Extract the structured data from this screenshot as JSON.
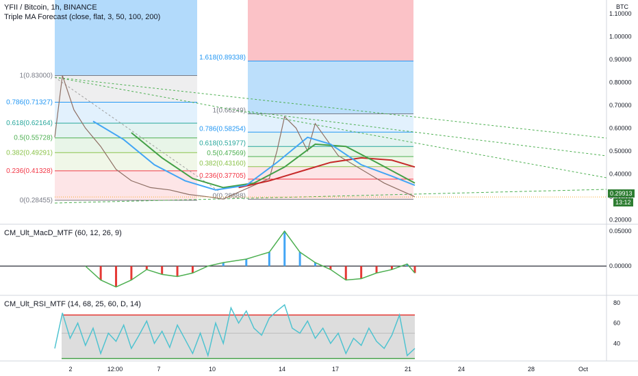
{
  "header": {
    "symbol": "YFII / Bitcoin, 1h, BINANCE",
    "indicator": "Triple MA Forecast (close, flat, 3, 50, 100, 200)",
    "currency": "BTC"
  },
  "badges": {
    "price": "0.29913",
    "countdown": "13:12"
  },
  "colors": {
    "bg": "#ffffff",
    "grid": "#e6e6e6",
    "accent_green": "#4caf50",
    "accent_red": "#e53935",
    "accent_blue": "#42a5f5",
    "rsi_line": "#4fc3d0"
  },
  "chart_data": [
    {
      "type": "line",
      "title": "YFII / Bitcoin, 1h, BINANCE",
      "y_ticks": [
        0.2,
        0.3,
        0.4,
        0.5,
        0.6,
        0.7,
        0.8,
        0.9,
        1.0,
        1.1
      ],
      "y_tick_labels": [
        "0.20000",
        "0.30000",
        "0.40000",
        "0.50000",
        "0.60000",
        "0.70000",
        "0.80000",
        "0.90000",
        "1.00000",
        "1.10000"
      ],
      "ylim": [
        0.18,
        1.16
      ],
      "x_tick_labels": [
        "2",
        "12:00",
        "7",
        "10",
        "14",
        "17",
        "21",
        "24",
        "28",
        "Oct"
      ],
      "last_price": 0.29913,
      "price_path": [
        {
          "t": 0,
          "v": 0.56
        },
        {
          "t": 2,
          "v": 0.83
        },
        {
          "t": 5,
          "v": 0.68
        },
        {
          "t": 8,
          "v": 0.6
        },
        {
          "t": 12,
          "v": 0.52
        },
        {
          "t": 16,
          "v": 0.42
        },
        {
          "t": 20,
          "v": 0.37
        },
        {
          "t": 25,
          "v": 0.34
        },
        {
          "t": 30,
          "v": 0.33
        },
        {
          "t": 35,
          "v": 0.31
        },
        {
          "t": 40,
          "v": 0.3
        },
        {
          "t": 44,
          "v": 0.29
        },
        {
          "t": 48,
          "v": 0.32
        },
        {
          "t": 52,
          "v": 0.35
        },
        {
          "t": 56,
          "v": 0.38
        },
        {
          "t": 58,
          "v": 0.5
        },
        {
          "t": 60,
          "v": 0.65
        },
        {
          "t": 63,
          "v": 0.6
        },
        {
          "t": 66,
          "v": 0.5
        },
        {
          "t": 68,
          "v": 0.62
        },
        {
          "t": 71,
          "v": 0.55
        },
        {
          "t": 74,
          "v": 0.48
        },
        {
          "t": 78,
          "v": 0.44
        },
        {
          "t": 82,
          "v": 0.4
        },
        {
          "t": 86,
          "v": 0.36
        },
        {
          "t": 90,
          "v": 0.33
        },
        {
          "t": 94,
          "v": 0.3
        }
      ],
      "ma_green": [
        {
          "t": 20,
          "v": 0.58
        },
        {
          "t": 28,
          "v": 0.47
        },
        {
          "t": 36,
          "v": 0.38
        },
        {
          "t": 44,
          "v": 0.34
        },
        {
          "t": 52,
          "v": 0.36
        },
        {
          "t": 60,
          "v": 0.43
        },
        {
          "t": 68,
          "v": 0.53
        },
        {
          "t": 76,
          "v": 0.52
        },
        {
          "t": 84,
          "v": 0.45
        },
        {
          "t": 94,
          "v": 0.36
        }
      ],
      "ma_blue": [
        {
          "t": 10,
          "v": 0.63
        },
        {
          "t": 18,
          "v": 0.55
        },
        {
          "t": 26,
          "v": 0.44
        },
        {
          "t": 34,
          "v": 0.37
        },
        {
          "t": 42,
          "v": 0.33
        },
        {
          "t": 50,
          "v": 0.35
        },
        {
          "t": 58,
          "v": 0.45
        },
        {
          "t": 66,
          "v": 0.56
        },
        {
          "t": 72,
          "v": 0.53
        },
        {
          "t": 80,
          "v": 0.44
        },
        {
          "t": 88,
          "v": 0.39
        },
        {
          "t": 94,
          "v": 0.35
        }
      ],
      "ma_red": [
        {
          "t": 48,
          "v": 0.34
        },
        {
          "t": 56,
          "v": 0.37
        },
        {
          "t": 64,
          "v": 0.41
        },
        {
          "t": 72,
          "v": 0.45
        },
        {
          "t": 80,
          "v": 0.47
        },
        {
          "t": 88,
          "v": 0.46
        },
        {
          "t": 94,
          "v": 0.43
        }
      ],
      "fib_levels_left": [
        {
          "label": "1(0.83000)",
          "value": 0.83,
          "color": "#787b86"
        },
        {
          "label": "0.786(0.71327)",
          "value": 0.71327,
          "color": "#2196f3"
        },
        {
          "label": "0.618(0.62164)",
          "value": 0.62164,
          "color": "#26a69a"
        },
        {
          "label": "0.5(0.55728)",
          "value": 0.55728,
          "color": "#4caf50"
        },
        {
          "label": "0.382(0.49291)",
          "value": 0.49291,
          "color": "#8bc34a"
        },
        {
          "label": "0.236(0.41328)",
          "value": 0.41328,
          "color": "#f23645"
        },
        {
          "label": "0(0.28455)",
          "value": 0.28455,
          "color": "#787b86"
        }
      ],
      "fib_levels_right": [
        {
          "label": "1.618(0.89338)",
          "value": 0.89338,
          "color": "#2196f3"
        },
        {
          "label": "1(0.66249)",
          "value": 0.66249,
          "color": "#787b86"
        },
        {
          "label": "0.786(0.58254)",
          "value": 0.58254,
          "color": "#2196f3"
        },
        {
          "label": "0.618(0.51977)",
          "value": 0.51977,
          "color": "#26a69a"
        },
        {
          "label": "0.5(0.47569)",
          "value": 0.47569,
          "color": "#4caf50"
        },
        {
          "label": "0.382(0.43160)",
          "value": 0.4316,
          "color": "#8bc34a"
        },
        {
          "label": "0.236(0.37705)",
          "value": 0.37705,
          "color": "#f23645"
        },
        {
          "label": "0(0.28888)",
          "value": 0.28888,
          "color": "#787b86"
        }
      ]
    },
    {
      "type": "line",
      "title": "CM_Ult_MacD_MTF (60, 12, 26, 9)",
      "y_tick_labels": [
        "0.05000",
        "0.00000"
      ],
      "y_ticks": [
        0.05,
        0.0
      ],
      "ylim": [
        -0.04,
        0.058
      ],
      "macd": [
        {
          "t": 8,
          "v": 0.0
        },
        {
          "t": 12,
          "v": -0.02
        },
        {
          "t": 16,
          "v": -0.03
        },
        {
          "t": 20,
          "v": -0.02
        },
        {
          "t": 24,
          "v": -0.005
        },
        {
          "t": 28,
          "v": -0.012
        },
        {
          "t": 32,
          "v": -0.015
        },
        {
          "t": 36,
          "v": -0.01
        },
        {
          "t": 40,
          "v": 0.0
        },
        {
          "t": 44,
          "v": 0.005
        },
        {
          "t": 50,
          "v": 0.01
        },
        {
          "t": 56,
          "v": 0.02
        },
        {
          "t": 60,
          "v": 0.05
        },
        {
          "t": 64,
          "v": 0.02
        },
        {
          "t": 68,
          "v": 0.005
        },
        {
          "t": 72,
          "v": -0.005
        },
        {
          "t": 76,
          "v": -0.02
        },
        {
          "t": 80,
          "v": -0.018
        },
        {
          "t": 84,
          "v": -0.01
        },
        {
          "t": 88,
          "v": -0.005
        },
        {
          "t": 92,
          "v": 0.003
        },
        {
          "t": 94,
          "v": -0.01
        }
      ]
    },
    {
      "type": "line",
      "title": "CM_Ult_RSI_MTF (14, 68, 25, 60, D, 14)",
      "y_tick_labels": [
        "80",
        "60",
        "40"
      ],
      "y_ticks": [
        80,
        60,
        40
      ],
      "ylim": [
        24,
        86
      ],
      "upper_band": 68,
      "lower_band": 25,
      "rsi": [
        {
          "t": 0,
          "v": 35
        },
        {
          "t": 2,
          "v": 70
        },
        {
          "t": 4,
          "v": 45
        },
        {
          "t": 6,
          "v": 60
        },
        {
          "t": 8,
          "v": 38
        },
        {
          "t": 10,
          "v": 55
        },
        {
          "t": 12,
          "v": 30
        },
        {
          "t": 14,
          "v": 50
        },
        {
          "t": 16,
          "v": 42
        },
        {
          "t": 18,
          "v": 58
        },
        {
          "t": 20,
          "v": 35
        },
        {
          "t": 22,
          "v": 48
        },
        {
          "t": 24,
          "v": 62
        },
        {
          "t": 26,
          "v": 40
        },
        {
          "t": 28,
          "v": 52
        },
        {
          "t": 30,
          "v": 36
        },
        {
          "t": 32,
          "v": 58
        },
        {
          "t": 34,
          "v": 44
        },
        {
          "t": 36,
          "v": 30
        },
        {
          "t": 38,
          "v": 50
        },
        {
          "t": 40,
          "v": 28
        },
        {
          "t": 42,
          "v": 60
        },
        {
          "t": 44,
          "v": 40
        },
        {
          "t": 46,
          "v": 75
        },
        {
          "t": 48,
          "v": 60
        },
        {
          "t": 50,
          "v": 72
        },
        {
          "t": 52,
          "v": 55
        },
        {
          "t": 54,
          "v": 48
        },
        {
          "t": 56,
          "v": 65
        },
        {
          "t": 58,
          "v": 72
        },
        {
          "t": 60,
          "v": 78
        },
        {
          "t": 62,
          "v": 55
        },
        {
          "t": 64,
          "v": 50
        },
        {
          "t": 66,
          "v": 62
        },
        {
          "t": 68,
          "v": 45
        },
        {
          "t": 70,
          "v": 55
        },
        {
          "t": 72,
          "v": 40
        },
        {
          "t": 74,
          "v": 50
        },
        {
          "t": 76,
          "v": 30
        },
        {
          "t": 78,
          "v": 45
        },
        {
          "t": 80,
          "v": 38
        },
        {
          "t": 82,
          "v": 55
        },
        {
          "t": 84,
          "v": 42
        },
        {
          "t": 86,
          "v": 35
        },
        {
          "t": 88,
          "v": 48
        },
        {
          "t": 90,
          "v": 68
        },
        {
          "t": 92,
          "v": 28
        },
        {
          "t": 94,
          "v": 35
        }
      ]
    }
  ]
}
